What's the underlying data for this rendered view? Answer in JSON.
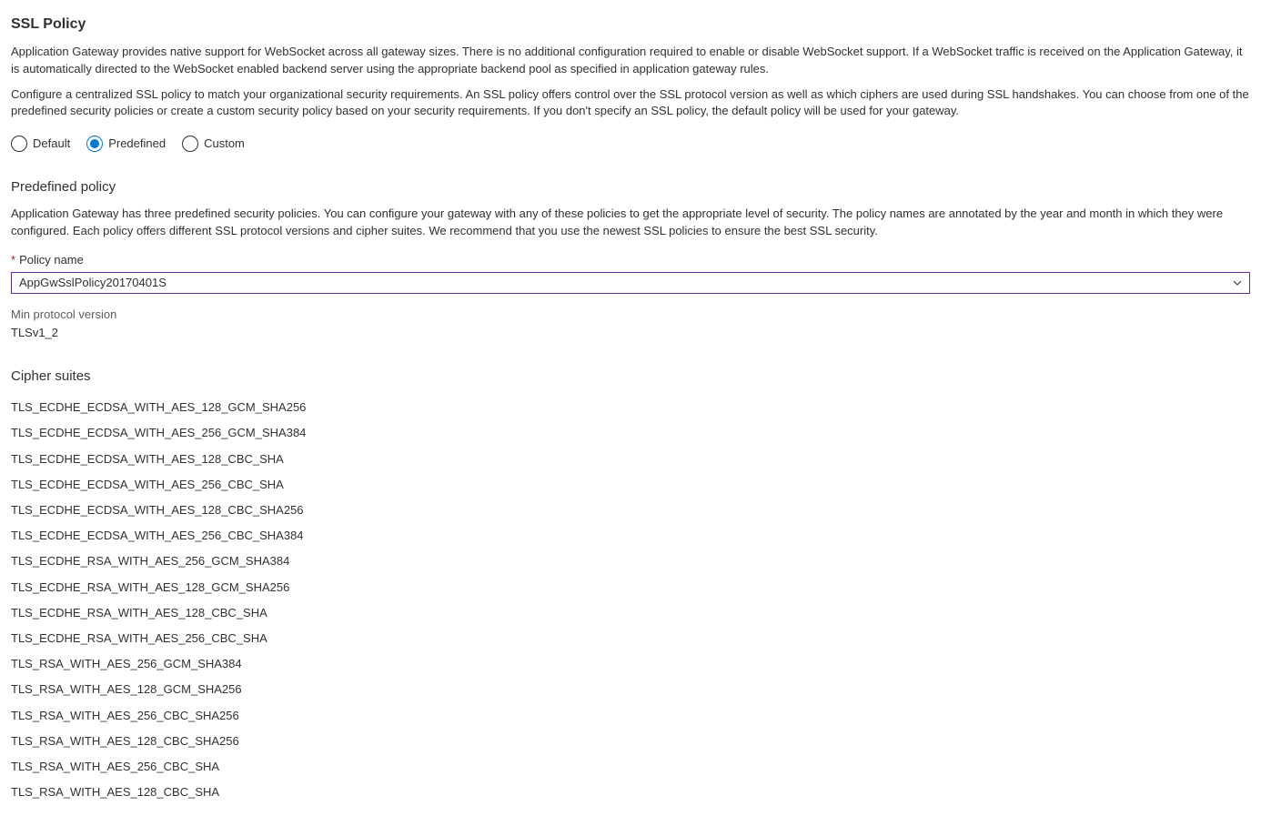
{
  "title": "SSL Policy",
  "paragraph1": "Application Gateway provides native support for WebSocket across all gateway sizes. There is no additional configuration required to enable or disable WebSocket support. If a WebSocket traffic is received on the Application Gateway, it is automatically directed to the WebSocket enabled backend server using the appropriate backend pool as specified in application gateway rules.",
  "paragraph2": "Configure a centralized SSL policy to match your organizational security requirements. An SSL policy offers control over the SSL protocol version as well as which ciphers are used during SSL handshakes. You can choose from one of the predefined security policies or create a custom security policy based on your security requirements. If you don't specify an SSL policy, the default policy will be used for your gateway.",
  "radios": {
    "default": "Default",
    "predefined": "Predefined",
    "custom": "Custom"
  },
  "predefined": {
    "heading": "Predefined policy",
    "desc": "Application Gateway has three predefined security policies. You can configure your gateway with any of these policies to get the appropriate level of security. The policy names are annotated by the year and month in which they were configured. Each policy offers different SSL protocol versions and cipher suites. We recommend that you use the newest SSL policies to ensure the best SSL security."
  },
  "policyNameLabel": "Policy name",
  "policyNameValue": "AppGwSslPolicy20170401S",
  "minProtocol": {
    "label": "Min protocol version",
    "value": "TLSv1_2"
  },
  "cipherHeading": "Cipher suites",
  "ciphers": [
    "TLS_ECDHE_ECDSA_WITH_AES_128_GCM_SHA256",
    "TLS_ECDHE_ECDSA_WITH_AES_256_GCM_SHA384",
    "TLS_ECDHE_ECDSA_WITH_AES_128_CBC_SHA",
    "TLS_ECDHE_ECDSA_WITH_AES_256_CBC_SHA",
    "TLS_ECDHE_ECDSA_WITH_AES_128_CBC_SHA256",
    "TLS_ECDHE_ECDSA_WITH_AES_256_CBC_SHA384",
    "TLS_ECDHE_RSA_WITH_AES_256_GCM_SHA384",
    "TLS_ECDHE_RSA_WITH_AES_128_GCM_SHA256",
    "TLS_ECDHE_RSA_WITH_AES_128_CBC_SHA",
    "TLS_ECDHE_RSA_WITH_AES_256_CBC_SHA",
    "TLS_RSA_WITH_AES_256_GCM_SHA384",
    "TLS_RSA_WITH_AES_128_GCM_SHA256",
    "TLS_RSA_WITH_AES_256_CBC_SHA256",
    "TLS_RSA_WITH_AES_128_CBC_SHA256",
    "TLS_RSA_WITH_AES_256_CBC_SHA",
    "TLS_RSA_WITH_AES_128_CBC_SHA"
  ]
}
